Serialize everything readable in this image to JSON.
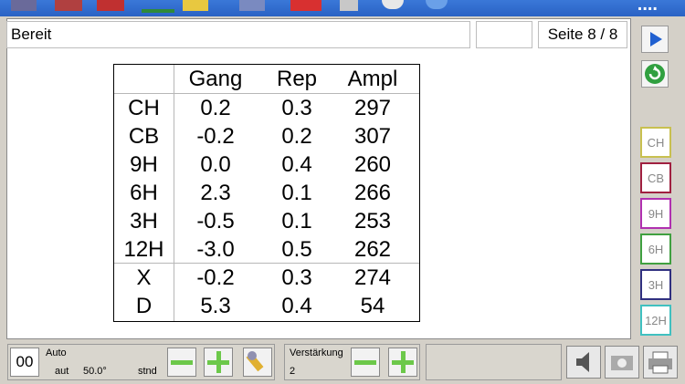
{
  "window": {
    "brand": "...."
  },
  "status": {
    "text": "Bereit",
    "blank": "",
    "page": "Seite 8 / 8"
  },
  "table": {
    "headers": [
      "Gang",
      "Rep",
      "Ampl"
    ],
    "rows": [
      {
        "label": "CH",
        "gang": "0.2",
        "rep": "0.3",
        "ampl": "297"
      },
      {
        "label": "CB",
        "gang": "-0.2",
        "rep": "0.2",
        "ampl": "307"
      },
      {
        "label": "9H",
        "gang": "0.0",
        "rep": "0.4",
        "ampl": "260"
      },
      {
        "label": "6H",
        "gang": "2.3",
        "rep": "0.1",
        "ampl": "266"
      },
      {
        "label": "3H",
        "gang": "-0.5",
        "rep": "0.1",
        "ampl": "253"
      },
      {
        "label": "12H",
        "gang": "-3.0",
        "rep": "0.5",
        "ampl": "262"
      },
      {
        "label": "X",
        "gang": "-0.2",
        "rep": "0.3",
        "ampl": "274"
      },
      {
        "label": "D",
        "gang": "5.3",
        "rep": "0.4",
        "ampl": "54"
      }
    ]
  },
  "side": {
    "buttons": [
      {
        "label": "CH",
        "color": "#c8c050"
      },
      {
        "label": "CB",
        "color": "#a02040"
      },
      {
        "label": "9H",
        "color": "#b030b0"
      },
      {
        "label": "6H",
        "color": "#40a040"
      },
      {
        "label": "3H",
        "color": "#303080"
      },
      {
        "label": "12H",
        "color": "#40c0c0"
      }
    ]
  },
  "bottom": {
    "counter": "00",
    "mode": "Auto",
    "aut_label": "aut",
    "angle": "50.0°",
    "stnd": "stnd",
    "gain_label": "Verstärkung",
    "gain_value": "2"
  }
}
